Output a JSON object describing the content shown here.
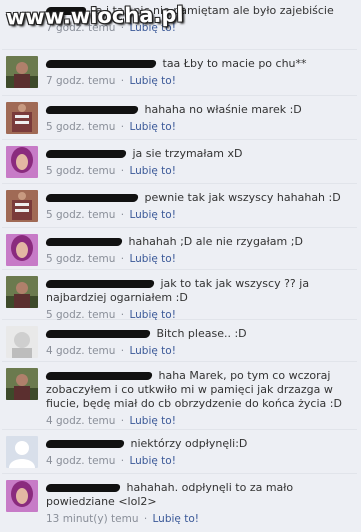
{
  "watermark": "www.wiocha.pl",
  "like_label": "Lubię to!",
  "separator": "·",
  "comments": [
    {
      "text": "Ja i tak nic nie pamiętam ale było zajebiście",
      "time": "7 godz. temu"
    },
    {
      "text": "taa Łby to macie po chu**",
      "time": "7 godz. temu"
    },
    {
      "text": "hahaha no właśnie marek :D",
      "time": "5 godz. temu"
    },
    {
      "text": "ja sie trzymałam xD",
      "time": "5 godz. temu"
    },
    {
      "text": "pewnie tak jak wszyscy hahahah :D",
      "time": "5 godz. temu"
    },
    {
      "text": "hahahah ;D ale nie rzygałam ;D",
      "time": "5 godz. temu"
    },
    {
      "text": "jak to tak jak wszyscy ?? ja najbardziej ogarniałem :D",
      "time": "5 godz. temu"
    },
    {
      "text": "Bitch please.. :D",
      "time": "4 godz. temu"
    },
    {
      "text": "haha Marek, po tym co wczoraj zobaczyłem i co utkwiło mi w pamięci jak drzazga w fiucie, będę miał do cb obrzydzenie do końca życia :D",
      "time": "4 godz. temu"
    },
    {
      "text": "niektórzy odpłynęli:D",
      "time": "4 godz. temu"
    },
    {
      "text": "hahahah. odpłynęli to za mało powiedziane <lol2>",
      "time": "13 minut(y) temu"
    }
  ]
}
